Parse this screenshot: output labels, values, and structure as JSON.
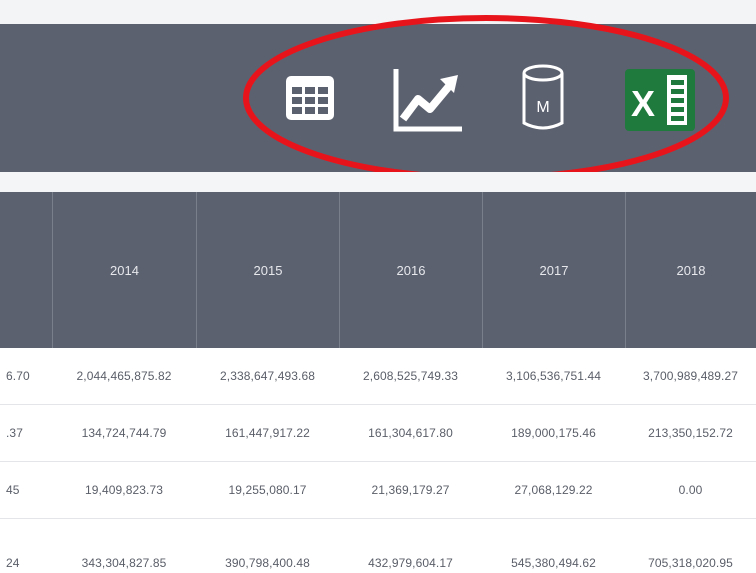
{
  "toolbar": {
    "icons": [
      {
        "name": "table-view-icon"
      },
      {
        "name": "chart-view-icon"
      },
      {
        "name": "database-icon",
        "letter": "M"
      },
      {
        "name": "excel-export-icon",
        "letter": "X"
      }
    ],
    "highlight_color": "#e8141b"
  },
  "table": {
    "columns": [
      "",
      "2014",
      "2015",
      "2016",
      "2017",
      "2018"
    ],
    "rows": [
      [
        "6.70",
        "2,044,465,875.82",
        "2,338,647,493.68",
        "2,608,525,749.33",
        "3,106,536,751.44",
        "3,700,989,489.27"
      ],
      [
        ".37",
        "134,724,744.79",
        "161,447,917.22",
        "161,304,617.80",
        "189,000,175.46",
        "213,350,152.72"
      ],
      [
        "45",
        "19,409,823.73",
        "19,255,080.17",
        "21,369,179.27",
        "27,068,129.22",
        "0.00"
      ],
      [
        "24",
        "343,304,827.85",
        "390,798,400.48",
        "432,979,604.17",
        "545,380,494.62",
        "705,318,020.95"
      ]
    ]
  },
  "colors": {
    "header_bg": "#5c6170",
    "header_text": "#e6e8ec",
    "cell_text": "#5a5e68",
    "excel_green": "#1f7a3e"
  }
}
